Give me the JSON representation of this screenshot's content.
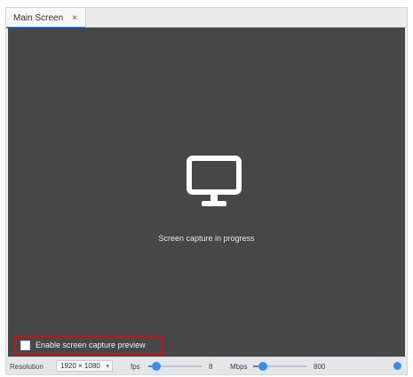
{
  "tab": {
    "title": "Main Screen",
    "close_glyph": "×"
  },
  "preview": {
    "status_text": "Screen capture in progress",
    "icon": "monitor-icon",
    "enable_label": "Enable screen capture preview",
    "enable_checked": false
  },
  "statusbar": {
    "resolution_label": "Resolution",
    "resolution_value": "1920 × 1080",
    "fps_label": "fps",
    "fps_value": "8",
    "fps_fraction": 0.15,
    "mbps_label": "Mbps",
    "mbps_value": "800",
    "mbps_fraction": 0.18
  },
  "colors": {
    "accent": "#3a8ee6",
    "preview_bg": "#474747",
    "highlight_border": "#c3141d"
  }
}
